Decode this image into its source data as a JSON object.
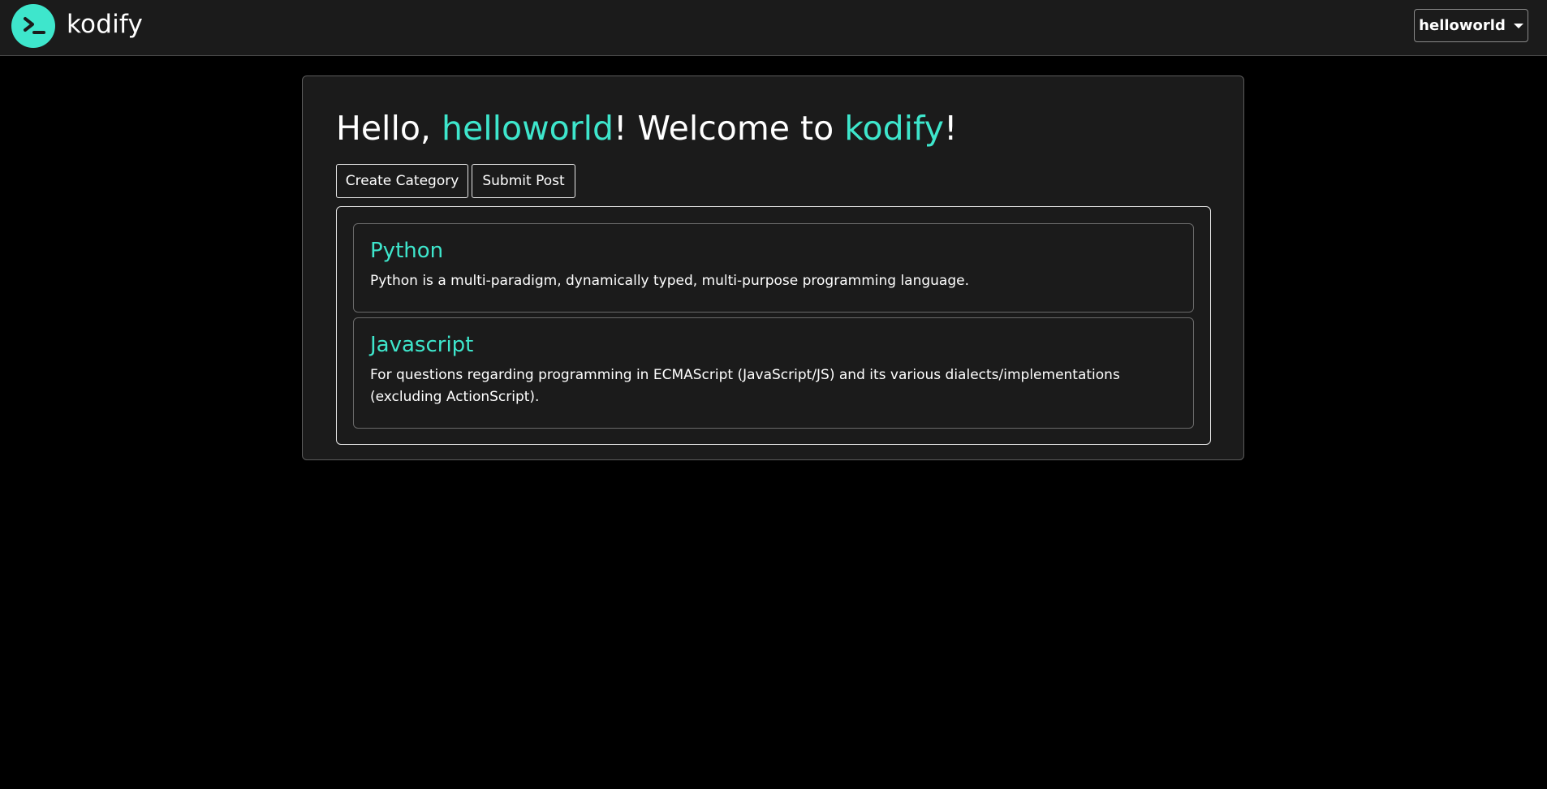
{
  "header": {
    "brand_name": "kodify",
    "user_menu_label": "helloworld"
  },
  "main": {
    "greeting": {
      "hello": "Hello,",
      "username": "helloworld",
      "mid": "! Welcome to",
      "site": "kodify",
      "end": "!"
    },
    "actions": {
      "create_category_label": "Create Category",
      "submit_post_label": "Submit Post"
    },
    "categories": [
      {
        "title": "Python",
        "description": "Python is a multi-paradigm, dynamically typed, multi-purpose programming language."
      },
      {
        "title": "Javascript",
        "description": "For questions regarding programming in ECMAScript (JavaScript/JS) and its various dialects/implementations (excluding ActionScript)."
      }
    ]
  },
  "colors": {
    "accent": "#3ee6cc",
    "background": "#000000",
    "surface": "#1b1b1b"
  },
  "icons": {
    "logo": "terminal-prompt-icon",
    "user_menu": "caret-down-icon"
  }
}
